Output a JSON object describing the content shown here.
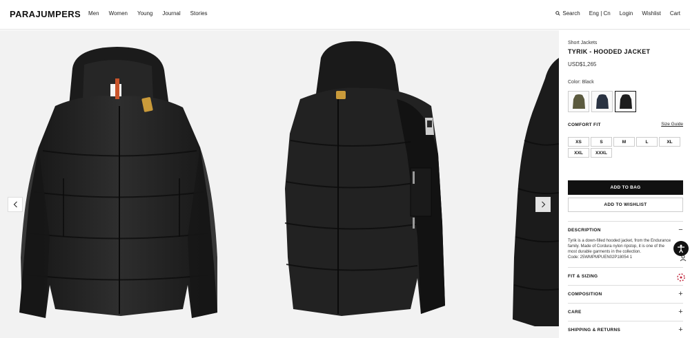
{
  "header": {
    "logo": "PARAJUMPERS",
    "nav": [
      "Men",
      "Women",
      "Young",
      "Journal",
      "Stories"
    ],
    "search_label": "Search",
    "lang_label": "Eng | Cn",
    "login_label": "Login",
    "wishlist_label": "Wishlist",
    "cart_label": "Cart"
  },
  "product": {
    "category": "Short Jackets",
    "title": "TYRIK - HOODED JACKET",
    "price": "USD$1,265",
    "color_label": "Color: Black",
    "swatches": [
      {
        "name": "olive",
        "color": "#5b5a3e"
      },
      {
        "name": "navy",
        "color": "#2a3342"
      },
      {
        "name": "black",
        "color": "#1e1e1e",
        "selected": true
      }
    ],
    "fit_label": "COMFORT FIT",
    "size_guide_label": "Size Guide",
    "sizes": [
      "XS",
      "S",
      "M",
      "L",
      "XL",
      "XXL",
      "XXXL"
    ],
    "add_to_bag_label": "ADD TO BAG",
    "add_to_wishlist_label": "ADD TO WISHLIST",
    "accordions": {
      "description": {
        "label": "DESCRIPTION",
        "sign": "−",
        "text": "Tyrik is a down-filled hooded jacket, from the Endurance family. Made of Cordura nylon ripstop, it is one of the most durable garments in the collection.",
        "code": "Code: 25WMPMPUEN02P18054 1"
      },
      "fit": {
        "label": "FIT & SIZING",
        "sign": "+"
      },
      "composition": {
        "label": "COMPOSITION",
        "sign": "+"
      },
      "care": {
        "label": "CARE",
        "sign": "+"
      },
      "shipping": {
        "label": "SHIPPING & RETURNS",
        "sign": "+"
      }
    }
  },
  "colors": {
    "accent": "#111111",
    "gallery_bg": "#f2f2f2",
    "jacket": "#1c1c1c",
    "tag_orange": "#d9892a",
    "zip_gold": "#c99a3a"
  }
}
